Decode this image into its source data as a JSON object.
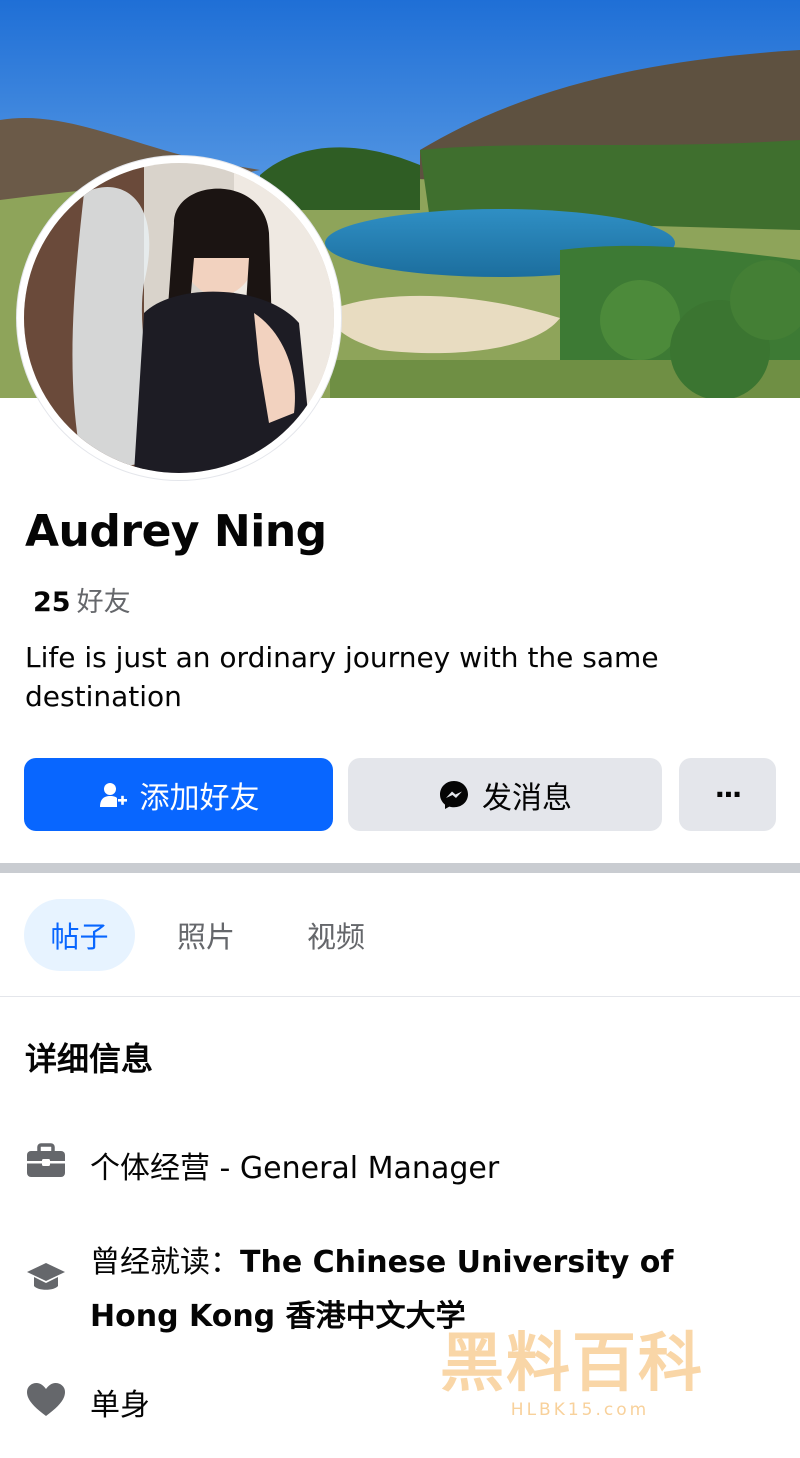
{
  "profile": {
    "name": "Audrey Ning",
    "friends_count": "25",
    "friends_label": "好友",
    "bio": "Life is just an ordinary journey with the same destination"
  },
  "actions": {
    "add_friend": "添加好友",
    "message": "发消息",
    "more": "···"
  },
  "tabs": [
    {
      "label": "帖子",
      "active": true
    },
    {
      "label": "照片",
      "active": false
    },
    {
      "label": "视频",
      "active": false
    }
  ],
  "details": {
    "title": "详细信息",
    "work": "个体经营 - General Manager",
    "education_prefix": "曾经就读：",
    "education_school": "The Chinese University of Hong Kong 香港中文大学",
    "relationship": "单身"
  },
  "watermark": {
    "title": "黑料百科",
    "url": "HLBK15.com"
  },
  "colors": {
    "primary": "#0866ff",
    "secondary_button": "#e4e6eb",
    "muted_text": "#65676b",
    "active_tab_bg": "#e7f3ff"
  }
}
